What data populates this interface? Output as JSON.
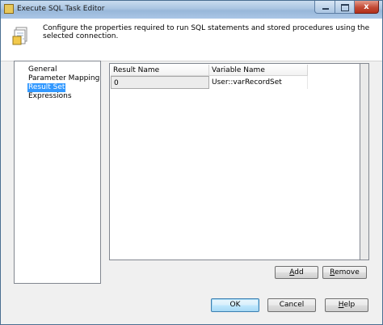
{
  "window": {
    "title": "Execute SQL Task Editor",
    "icon": "sql-task-icon",
    "close_glyph": "x"
  },
  "header": {
    "description": "Configure the properties required to run SQL statements and stored procedures using the selected connection.",
    "icon": "task-config-icon"
  },
  "nav": {
    "items": [
      {
        "label": "General"
      },
      {
        "label": "Parameter Mapping"
      },
      {
        "label": "Result Set"
      },
      {
        "label": "Expressions"
      }
    ],
    "selected_index": 2
  },
  "grid": {
    "columns": [
      "Result Name",
      "Variable Name"
    ],
    "rows": [
      {
        "result_name": "0",
        "variable_name": "User::varRecordSet"
      }
    ]
  },
  "buttons": {
    "add": {
      "pre": "",
      "mnemonic": "A",
      "post": "dd"
    },
    "remove": {
      "pre": "",
      "mnemonic": "R",
      "post": "emove"
    },
    "ok": "OK",
    "cancel": "Cancel",
    "help": {
      "pre": "",
      "mnemonic": "H",
      "post": "elp"
    }
  },
  "colors": {
    "selection": "#3399ff",
    "titlebar": "#a9c4e1",
    "close_button": "#c24a35"
  }
}
